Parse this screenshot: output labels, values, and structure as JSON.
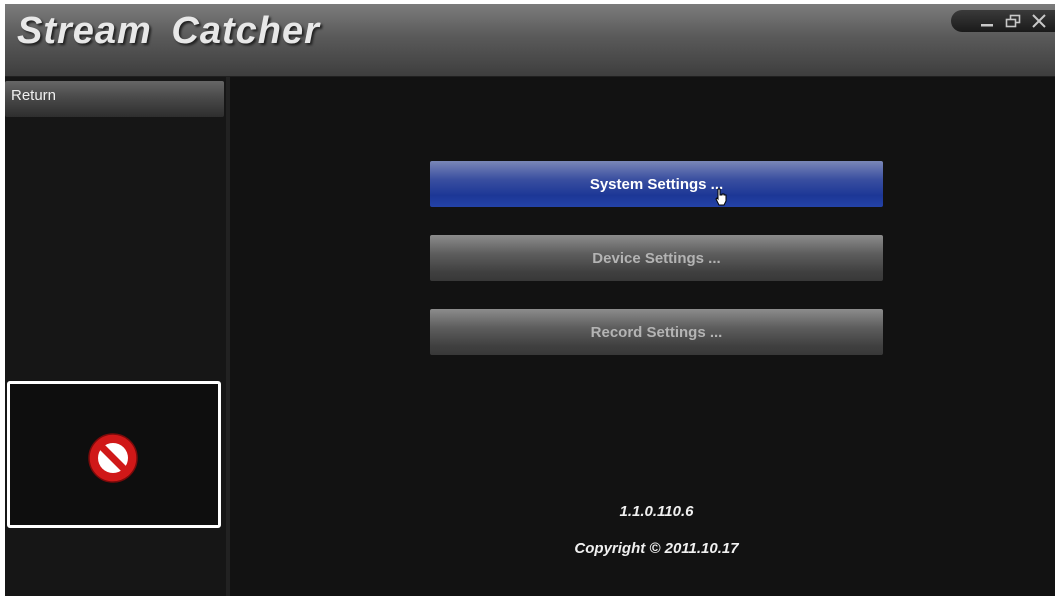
{
  "app": {
    "title": "Stream Catcher"
  },
  "window_controls": {
    "minimize_icon": "minimize-icon",
    "restore_icon": "restore-icon",
    "close_icon": "close-icon"
  },
  "sidebar": {
    "return_label": "Return",
    "preview": {
      "status_icon": "no-signal-icon"
    }
  },
  "menu": {
    "buttons": [
      {
        "label": "System Settings ...",
        "state": "active"
      },
      {
        "label": "Device Settings ...",
        "state": "inactive"
      },
      {
        "label": "Record Settings ...",
        "state": "inactive"
      }
    ]
  },
  "footer": {
    "version": "1.1.0.110.6",
    "copyright": "Copyright © 2011.10.17"
  },
  "colors": {
    "background": "#121212",
    "active_button": "#1c3796",
    "inactive_button": "#5e5e5e",
    "no_signal": "#d01818"
  }
}
